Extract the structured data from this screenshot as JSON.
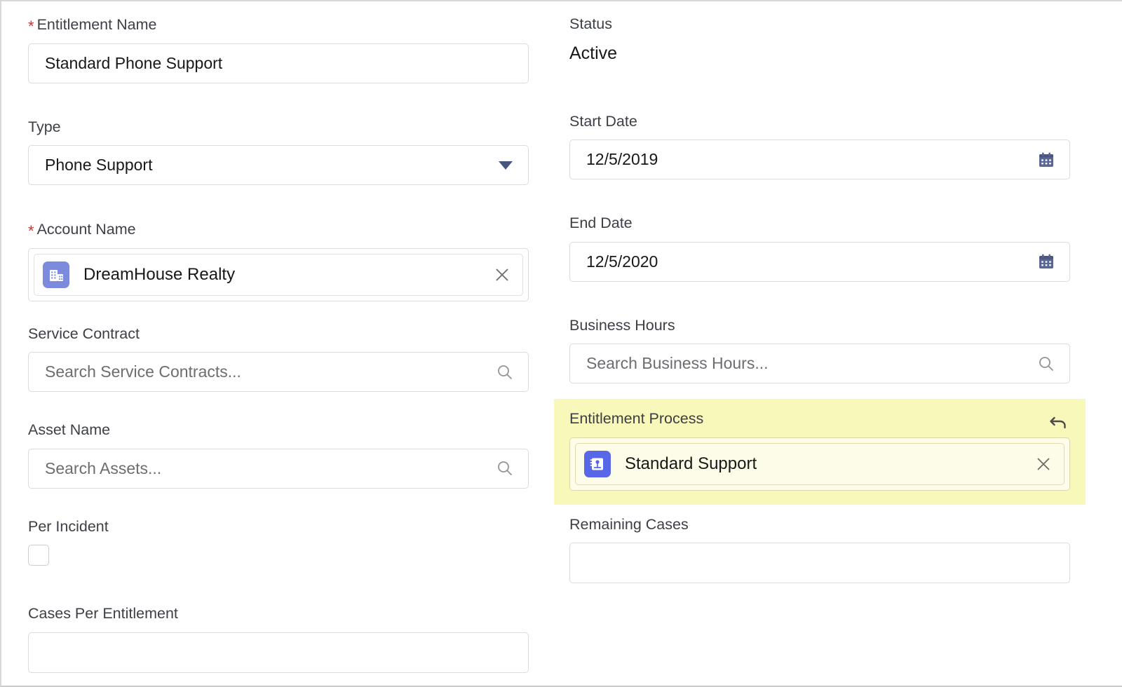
{
  "form": {
    "left_column": {
      "entitlement_name": {
        "label": "Entitlement Name",
        "required": true,
        "value": "Standard Phone Support"
      },
      "type": {
        "label": "Type",
        "required": false,
        "value": "Phone Support",
        "icon": "chevron-down-icon"
      },
      "account_name": {
        "label": "Account Name",
        "required": true,
        "value": "DreamHouse Realty",
        "icon": "account-building-icon",
        "icon_color": "#7d8bdc",
        "clear_icon": "close-icon"
      },
      "service_contract": {
        "label": "Service Contract",
        "required": false,
        "value": "",
        "placeholder": "Search Service Contracts...",
        "icon": "search-icon"
      },
      "asset_name": {
        "label": "Asset Name",
        "required": false,
        "value": "",
        "placeholder": "Search Assets...",
        "icon": "search-icon"
      },
      "per_incident": {
        "label": "Per Incident",
        "checked": false
      },
      "cases_per_entitlement": {
        "label": "Cases Per Entitlement",
        "value": ""
      }
    },
    "right_column": {
      "status": {
        "label": "Status",
        "value": "Active",
        "readonly": true
      },
      "start_date": {
        "label": "Start Date",
        "value": "12/5/2019",
        "icon": "calendar-icon",
        "icon_color": "#5a6795"
      },
      "end_date": {
        "label": "End Date",
        "value": "12/5/2020",
        "icon": "calendar-icon",
        "icon_color": "#5a6795"
      },
      "business_hours": {
        "label": "Business Hours",
        "value": "",
        "placeholder": "Search Business Hours...",
        "icon": "search-icon"
      },
      "entitlement_process": {
        "label": "Entitlement Process",
        "value": "Standard Support",
        "icon": "entitlement-process-icon",
        "icon_color": "#5867e8",
        "clear_icon": "close-icon",
        "undo_icon": "undo-icon",
        "highlighted": true,
        "highlight_color": "#f8f8ba"
      },
      "remaining_cases": {
        "label": "Remaining Cases",
        "value": ""
      }
    }
  }
}
